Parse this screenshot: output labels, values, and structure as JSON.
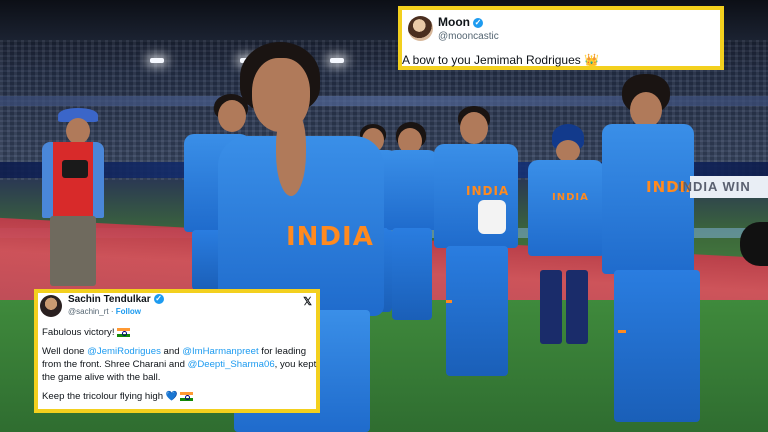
{
  "scene": {
    "description_label": "photo",
    "jersey_text": "INDIA",
    "board_text": "INDIA WIN"
  },
  "tweet_moon": {
    "name": "Moon",
    "handle": "@mooncastic",
    "text": "A bow to you Jemimah Rodrigues",
    "emoji": "👑",
    "verified_icon": "verified-badge-icon"
  },
  "tweet_sachin": {
    "name": "Sachin Tendulkar",
    "handle": "@sachin_rt",
    "separator": " · ",
    "follow_label": "Follow",
    "platform_icon": "x-logo-icon",
    "line1": "Fabulous victory!",
    "line2_pre": "Well done ",
    "mention1": "@JemiRodrigues",
    "line2_mid": " and ",
    "mention2": "@ImHarmanpreet",
    "line2_post": " for leading from the front. Shree Charani and ",
    "mention3": "@Deepti_Sharma06",
    "line2_end": ", you kept the game alive with the ball.",
    "line3": "Keep the tricolour flying high"
  },
  "colors": {
    "card_border": "#f3d01e",
    "mention": "#1d9bf0",
    "jersey_blue": "#1f6bcc"
  }
}
